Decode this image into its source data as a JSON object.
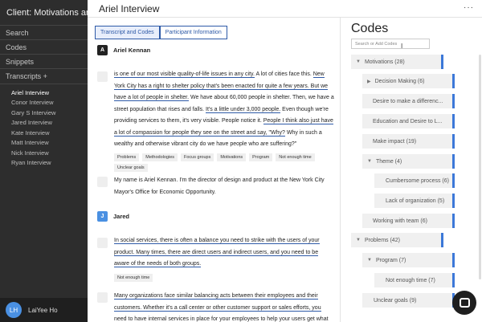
{
  "sidebar": {
    "client": "Client: Motivations ar",
    "nav": [
      "Search",
      "Codes",
      "Snippets"
    ],
    "transcripts_label": "Transcripts +",
    "transcripts": [
      "Ariel Interview",
      "Conor Interview",
      "Gary S Interview",
      "Jared Interview",
      "Kate Interview",
      "Matt Interview",
      "Nick Interview",
      "Ryan Interview"
    ],
    "user_initials": "LH",
    "user_name": "LaiYee Ho"
  },
  "header": {
    "title": "Ariel Interview",
    "more": "···"
  },
  "tabs": [
    "Transcript and Codes",
    "Participant Information"
  ],
  "transcript": {
    "speaker1": {
      "initial": "A",
      "name": "Ariel Kennan"
    },
    "para1": {
      "s1": "is one of our most visible quality-of-life issues in any city.",
      "s2": " A lot of cities face this. ",
      "s3": "New York City has a right to shelter policy that's been enacted for quite a few years. But we have a lot of people in shelter.",
      "s4": " We have about 60,000 people in shelter. Then, we have a street population that rises and falls. ",
      "s5": "It's a little under 3,000 people.",
      "s6": " Even though we're providing services to them, it's very visible. People notice it. ",
      "s7": "People I think also just have a lot of compassion for people they see on the street and say, \"Why?",
      "s8": " Why in such a wealthy and otherwise vibrant city do we have people who are suffering?\""
    },
    "tags1": [
      "Problems",
      "Methodologies",
      "Focus groups",
      "Motivations",
      "Program",
      "Not enough time",
      "Unclear goals"
    ],
    "para2": "My name is Ariel Kennan. I'm the director of design and product at the New York City Mayor's Office for Economic Opportunity.",
    "speaker2": {
      "initial": "J",
      "name": "Jared"
    },
    "para3": "In social services, there is often a balance you need to strike with the users of your product. Many times, there are direct users and indirect users, and you need to be aware of the needs of both groups.",
    "tags3": [
      "Not enough time"
    ],
    "para4": "Many organizations face similar balancing acts between their employees and their customers. Whether it's a call center or other customer support or sales efforts, you need to have internal services in place for your employees to help your users get what they need."
  },
  "codes": {
    "title": "Codes",
    "search_placeholder": "Search or Add Codes",
    "items": [
      {
        "label": "Motivations (28)",
        "arrow": "▼"
      },
      {
        "label": "Decision Making (6)",
        "arrow": "▶"
      },
      {
        "label": "Desire to make a differenc...",
        "arrow": ""
      },
      {
        "label": "Education and Desire to L...",
        "arrow": ""
      },
      {
        "label": "Make impact (19)",
        "arrow": ""
      },
      {
        "label": "Theme (4)",
        "arrow": "▼"
      },
      {
        "label": "Cumbersome process (6)",
        "arrow": ""
      },
      {
        "label": "Lack of organization (5)",
        "arrow": ""
      },
      {
        "label": "Working with team (6)",
        "arrow": ""
      },
      {
        "label": "Problems (42)",
        "arrow": "▼"
      },
      {
        "label": "Program (7)",
        "arrow": "▼"
      },
      {
        "label": "Not enough time (7)",
        "arrow": ""
      },
      {
        "label": "Unclear goals (9)",
        "arrow": ""
      }
    ]
  }
}
